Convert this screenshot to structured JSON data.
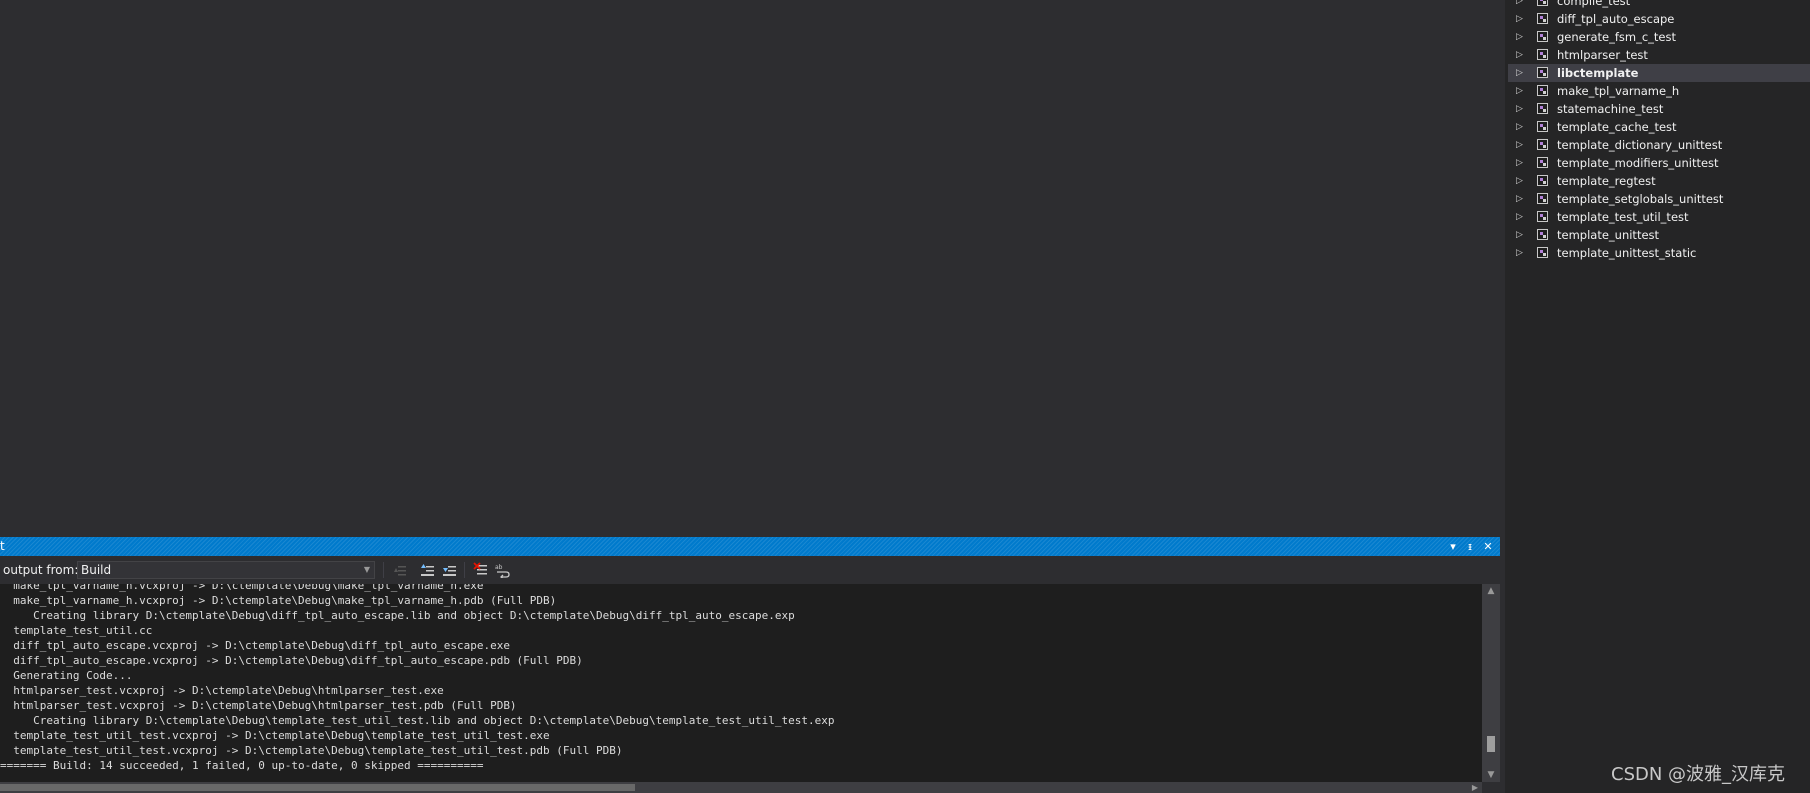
{
  "solution_explorer": {
    "items": [
      {
        "label": "compile_test",
        "selected": false
      },
      {
        "label": "diff_tpl_auto_escape",
        "selected": false
      },
      {
        "label": "generate_fsm_c_test",
        "selected": false
      },
      {
        "label": "htmlparser_test",
        "selected": false
      },
      {
        "label": "libctemplate",
        "selected": true
      },
      {
        "label": "make_tpl_varname_h",
        "selected": false
      },
      {
        "label": "statemachine_test",
        "selected": false
      },
      {
        "label": "template_cache_test",
        "selected": false
      },
      {
        "label": "template_dictionary_unittest",
        "selected": false
      },
      {
        "label": "template_modifiers_unittest",
        "selected": false
      },
      {
        "label": "template_regtest",
        "selected": false
      },
      {
        "label": "template_setglobals_unittest",
        "selected": false
      },
      {
        "label": "template_test_util_test",
        "selected": false
      },
      {
        "label": "template_unittest",
        "selected": false
      },
      {
        "label": "template_unittest_static",
        "selected": false
      }
    ],
    "expand_icon": "triangle-right-icon",
    "project_icon": "cpp-project-icon"
  },
  "output": {
    "title": "t",
    "show_output_from_label": "output from:",
    "source_select_value": "Build",
    "toolbar_icons": [
      "goto-prev-message-icon",
      "find-message-up-icon",
      "find-message-down-icon",
      "clear-all-icon",
      "toggle-word-wrap-icon"
    ],
    "title_buttons": [
      "dropdown-icon",
      "pin-icon",
      "close-icon"
    ],
    "lines": [
      "  make_tpl_varname_h.vcxproj -> D:\\ctemplate\\Debug\\make_tpl_varname_h.exe",
      "  make_tpl_varname_h.vcxproj -> D:\\ctemplate\\Debug\\make_tpl_varname_h.pdb (Full PDB)",
      "     Creating library D:\\ctemplate\\Debug\\diff_tpl_auto_escape.lib and object D:\\ctemplate\\Debug\\diff_tpl_auto_escape.exp",
      "  template_test_util.cc",
      "  diff_tpl_auto_escape.vcxproj -> D:\\ctemplate\\Debug\\diff_tpl_auto_escape.exe",
      "  diff_tpl_auto_escape.vcxproj -> D:\\ctemplate\\Debug\\diff_tpl_auto_escape.pdb (Full PDB)",
      "  Generating Code...",
      "  htmlparser_test.vcxproj -> D:\\ctemplate\\Debug\\htmlparser_test.exe",
      "  htmlparser_test.vcxproj -> D:\\ctemplate\\Debug\\htmlparser_test.pdb (Full PDB)",
      "     Creating library D:\\ctemplate\\Debug\\template_test_util_test.lib and object D:\\ctemplate\\Debug\\template_test_util_test.exp",
      "  template_test_util_test.vcxproj -> D:\\ctemplate\\Debug\\template_test_util_test.exe",
      "  template_test_util_test.vcxproj -> D:\\ctemplate\\Debug\\template_test_util_test.pdb (Full PDB)",
      "======= Build: 14 succeeded, 1 failed, 0 up-to-date, 0 skipped =========="
    ]
  },
  "colors": {
    "title_bar": "#007acc",
    "background": "#2d2d30",
    "output_background": "#1e1e1e",
    "selected_item": "#3f3f46"
  },
  "watermark": "CSDN @波雅_汉库克"
}
